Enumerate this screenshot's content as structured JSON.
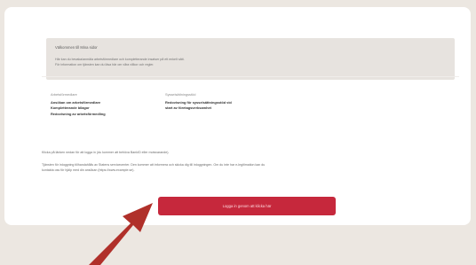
{
  "welcome": {
    "title": "Välkommen till Mina sidor",
    "lines": [
      "Här kan du bevaka/anmäla arbetsförmedlare och kompletterande insatser på ett enkelt sätt.",
      "För information om tjänsten kan du läsa här om våra villkor och regler."
    ]
  },
  "columns": [
    {
      "heading": "Arbetsförmedlare",
      "links": [
        "Ansökan om arbetsförmedlare",
        "Kompletterande bilagor",
        "Redovisning av arbetsförmedling"
      ]
    },
    {
      "heading": "Sysselsättningsstöd",
      "links": [
        "Redovisning för sysselsättningsstöd vid",
        "start av företagsverksamhet"
      ]
    }
  ],
  "info": {
    "line1": "Klicka på länken nedan för att logga in (du kommer att behöva BankID eller motsvarande).",
    "line2": "Tjänsten för inloggning tillhandahålls av Statens servicecenter. Den kommer att informera och skicka dig till inloggningen. Om du inte har e-legitimation kan du",
    "line3": "kontakta oss för hjälp med din ansökan (https://www.example.se)."
  },
  "login_button": {
    "label": "Logga in genom att klicka här"
  },
  "colors": {
    "background": "#ece7e1",
    "card": "#ffffff",
    "welcome_box": "#e7e3df",
    "button": "#c6283c",
    "arrow": "#b0302a"
  },
  "icons": {
    "pointer": "red-arrow-icon"
  }
}
